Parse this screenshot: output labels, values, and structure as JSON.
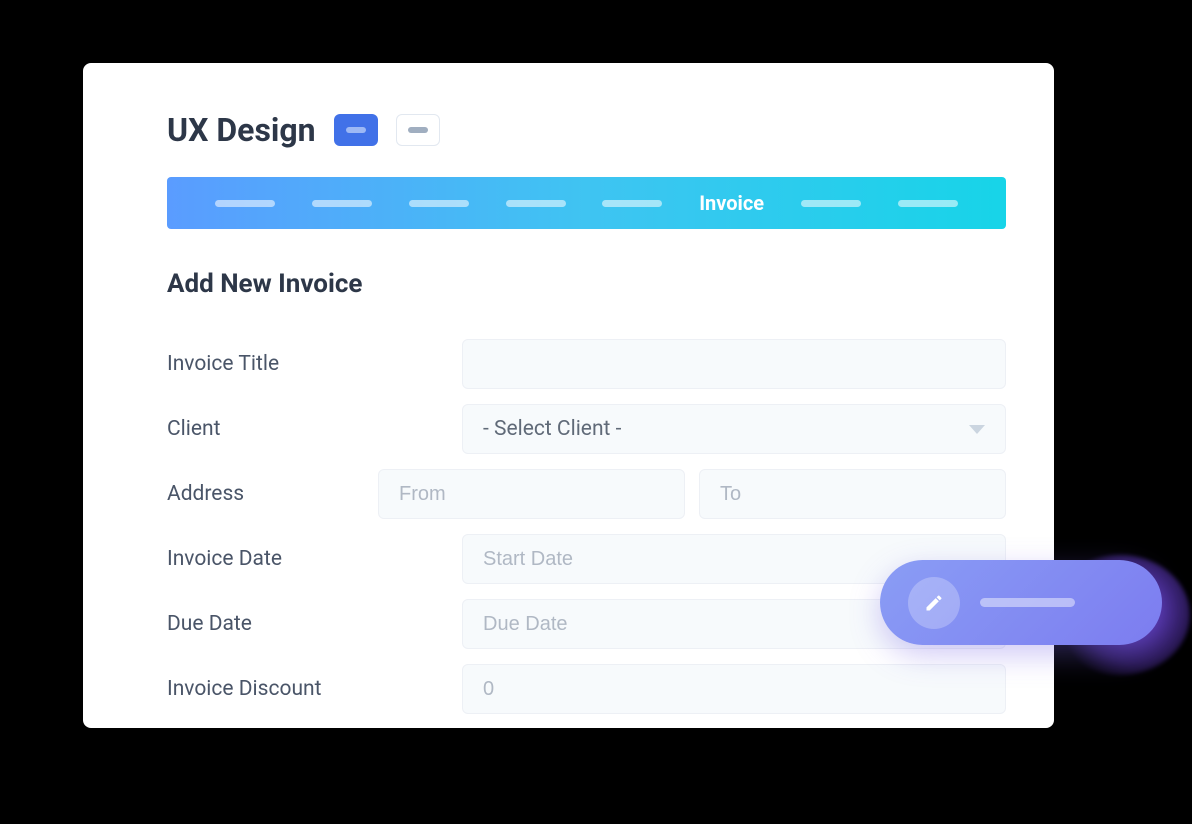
{
  "header": {
    "title": "UX Design"
  },
  "tabs": {
    "active_label": "Invoice"
  },
  "section": {
    "title": "Add New Invoice"
  },
  "form": {
    "invoice_title": {
      "label": "Invoice Title",
      "value": ""
    },
    "client": {
      "label": "Client",
      "placeholder": "- Select Client -"
    },
    "address": {
      "label": "Address",
      "from_placeholder": "From",
      "to_placeholder": "To"
    },
    "invoice_date": {
      "label": "Invoice Date",
      "placeholder": "Start Date"
    },
    "due_date": {
      "label": "Due Date",
      "placeholder": "Due Date"
    },
    "discount": {
      "label": "Invoice Discount",
      "placeholder": "0"
    }
  },
  "fab": {
    "icon": "pencil-icon"
  }
}
